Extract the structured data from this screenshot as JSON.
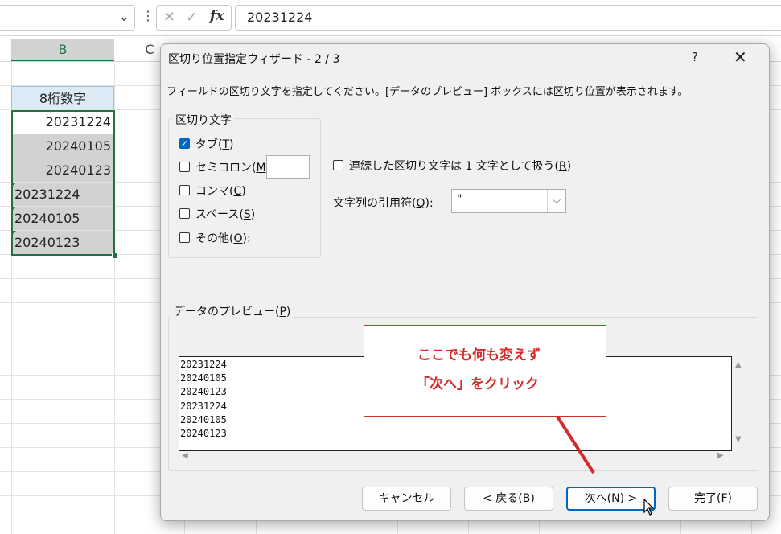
{
  "formula_bar": {
    "formula_value": "20231224",
    "icons": [
      "chevron-down-icon",
      "more-vertical-icon",
      "cancel-icon",
      "check-icon",
      "fx-icon"
    ],
    "cancel_glyph": "✕",
    "check_glyph": "✓",
    "fx_label": "fx"
  },
  "sheet": {
    "columns": [
      "B",
      "C"
    ],
    "header_cell": "8桁数字",
    "cells": [
      "20231224",
      "20240105",
      "20240123",
      "20231224",
      "20240105",
      "20240123"
    ],
    "accent_color": "#217346"
  },
  "dialog": {
    "title": "区切り位置指定ウィザード - 2 / 3",
    "help": "?",
    "close": "✕",
    "instruction": "フィールドの区切り文字を指定してください。[データのプレビュー] ボックスには区切り位置が表示されます。",
    "delimiters": {
      "legend": "区切り文字",
      "tab": {
        "text": "タブ(",
        "key": "T",
        "checked": true
      },
      "semicolon": {
        "text": "セミコロン(",
        "key": "M",
        "checked": false
      },
      "comma": {
        "text": "コンマ(",
        "key": "C",
        "checked": false
      },
      "space": {
        "text": "スペース(",
        "key": "S",
        "checked": false
      },
      "other": {
        "text": "その他(",
        "key": "O",
        "suffix": "):",
        "checked": false,
        "value": ""
      }
    },
    "consecutive": {
      "text": "連続した区切り文字は 1 文字として扱う(",
      "key": "R",
      "checked": false
    },
    "text_qualifier": {
      "text": "文字列の引用符(",
      "key": "Q",
      "suffix": "):",
      "value": "\""
    },
    "preview": {
      "legend_text": "データのプレビュー(",
      "legend_key": "P",
      "rows": [
        "20231224",
        "20240105",
        "20240123",
        "20231224",
        "20240105",
        "20240123"
      ]
    },
    "buttons": {
      "cancel": "キャンセル",
      "back_prefix": "< 戻る(",
      "back_key": "B",
      "next_prefix": "次へ(",
      "next_key": "N",
      "next_suffix": ") >",
      "finish_prefix": "完了(",
      "finish_key": "F"
    }
  },
  "annotation": {
    "line1": "ここでも何も変えず",
    "line2": "「次へ」をクリック",
    "color": "#d42a2a"
  }
}
